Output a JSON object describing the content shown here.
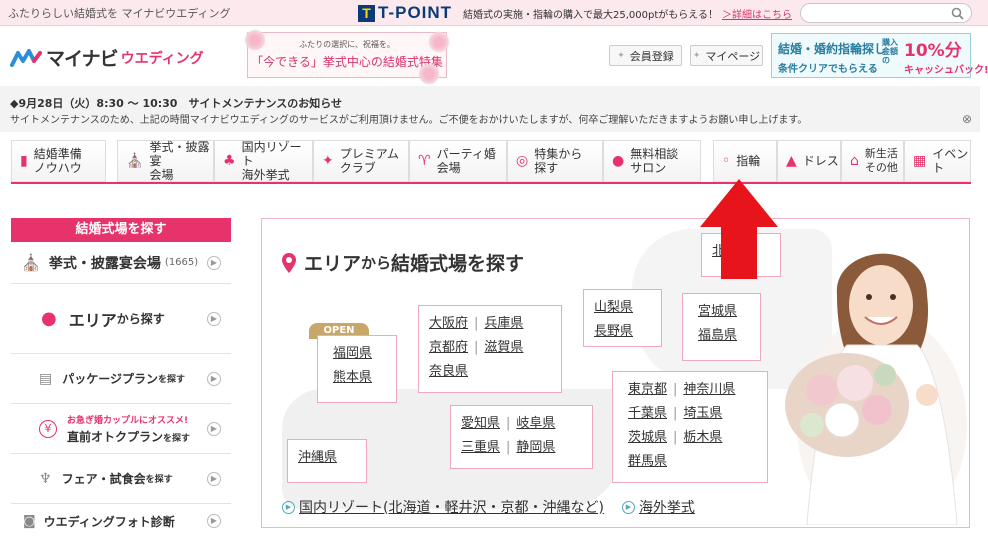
{
  "topbar": {
    "tagline": "ふたりらしい結婚式を マイナビウエディング",
    "tpoint_word": "T-POINT",
    "tpoint_t": "T",
    "tpoint_text": "結婚式の実施・指輪の購入で最大25,000ptがもらえる！",
    "tpoint_link": "＞詳細はこちら",
    "search_placeholder": ""
  },
  "header": {
    "logo_main": "マイナビ",
    "logo_sub": "ウエディング",
    "feature_small": "ふたりの選択に、祝福を。",
    "feature_main": "「今できる」挙式中心の結婚式特集",
    "member_button": "会員登録",
    "mypage_button": "マイページ",
    "cashback": {
      "line1": "結婚・婚約指輪探し",
      "line2": "条件クリアでもらえる",
      "percent_prefix": "購入金額の",
      "percent": "10%分",
      "sub": "キャッシュバック!"
    }
  },
  "notice": {
    "title": "◆9月28日（火）8:30 〜 10:30　サイトメンテナンスのお知らせ",
    "body": "サイトメンテナンスのため、上記の時間マイナビウエディングのサービスがご利用頂けません。ご不便をおかけいたしますが、何卒ご理解いただきますようお願い申し上げます。",
    "close": "⊗"
  },
  "nav": {
    "items": [
      {
        "label1": "結婚準備",
        "label2": "ノウハウ",
        "icon": "book-icon",
        "glyph": "▮"
      },
      {
        "label1": "挙式・披露宴",
        "label2": "会場",
        "icon": "chapel-icon",
        "glyph": "⛪"
      },
      {
        "label1": "国内リゾート",
        "label2": "海外挙式",
        "icon": "palm-icon",
        "glyph": "♣"
      },
      {
        "label1": "プレミアム",
        "label2": "クラブ",
        "icon": "sparkle-icon",
        "glyph": "✦"
      },
      {
        "label1": "パーティ婚",
        "label2": "会場",
        "icon": "glasses-icon",
        "glyph": "♈"
      },
      {
        "label1": "特集から",
        "label2": "探す",
        "icon": "bulb-icon",
        "glyph": "◎"
      },
      {
        "label1": "無料相談",
        "label2": "サロン",
        "icon": "people-icon",
        "glyph": "●"
      },
      {
        "label1": "指輪",
        "label2": "",
        "icon": "ring-icon",
        "glyph": "◦"
      },
      {
        "label1": "ドレス",
        "label2": "",
        "icon": "dress-icon",
        "glyph": "▲"
      },
      {
        "label1": "新生活",
        "label2": "その他",
        "icon": "house-icon",
        "glyph": "⌂"
      },
      {
        "label1": "イベント",
        "label2": "",
        "icon": "calendar-icon",
        "glyph": "▦"
      }
    ]
  },
  "sidebar": {
    "header": "結婚式場を探す",
    "venues_label": "挙式・披露宴会場",
    "venues_count": "(1665)",
    "area_big": "エリア",
    "area_small": "から探す",
    "package_big": "パッケージプラン",
    "package_small": "を探す",
    "urgent_note": "お急ぎ婚カップルにオススメ!",
    "urgent_big": "直前オトクプラン",
    "urgent_small": "を探す",
    "fair_big": "フェア・試食会",
    "fair_small": "を探す",
    "photo_label": "ウエディングフォト診断"
  },
  "panel": {
    "title_big": "エリア",
    "title_small": "から",
    "title_big2": "結婚式場を探す",
    "open_badge": "OPEN",
    "areas": {
      "hokkaido": "北海道",
      "kyushu_1": "福岡県",
      "kyushu_2": "熊本県",
      "okinawa": "沖縄県",
      "kansai": [
        "大阪府",
        "兵庫県",
        "京都府",
        "滋賀県",
        "奈良県"
      ],
      "tokai": [
        "愛知県",
        "岐阜県",
        "三重県",
        "静岡県"
      ],
      "koshinetsu": [
        "山梨県",
        "長野県"
      ],
      "tohoku": [
        "宮城県",
        "福島県"
      ],
      "kanto": [
        "東京都",
        "神奈川県",
        "千葉県",
        "埼玉県",
        "茨城県",
        "栃木県",
        "群馬県"
      ]
    },
    "link_domestic": "国内リゾート(北海道・軽井沢・京都・沖縄など)",
    "link_overseas": "海外挙式"
  },
  "colors": {
    "accent": "#e6336c",
    "highlight_arrow": "#e8141c"
  }
}
